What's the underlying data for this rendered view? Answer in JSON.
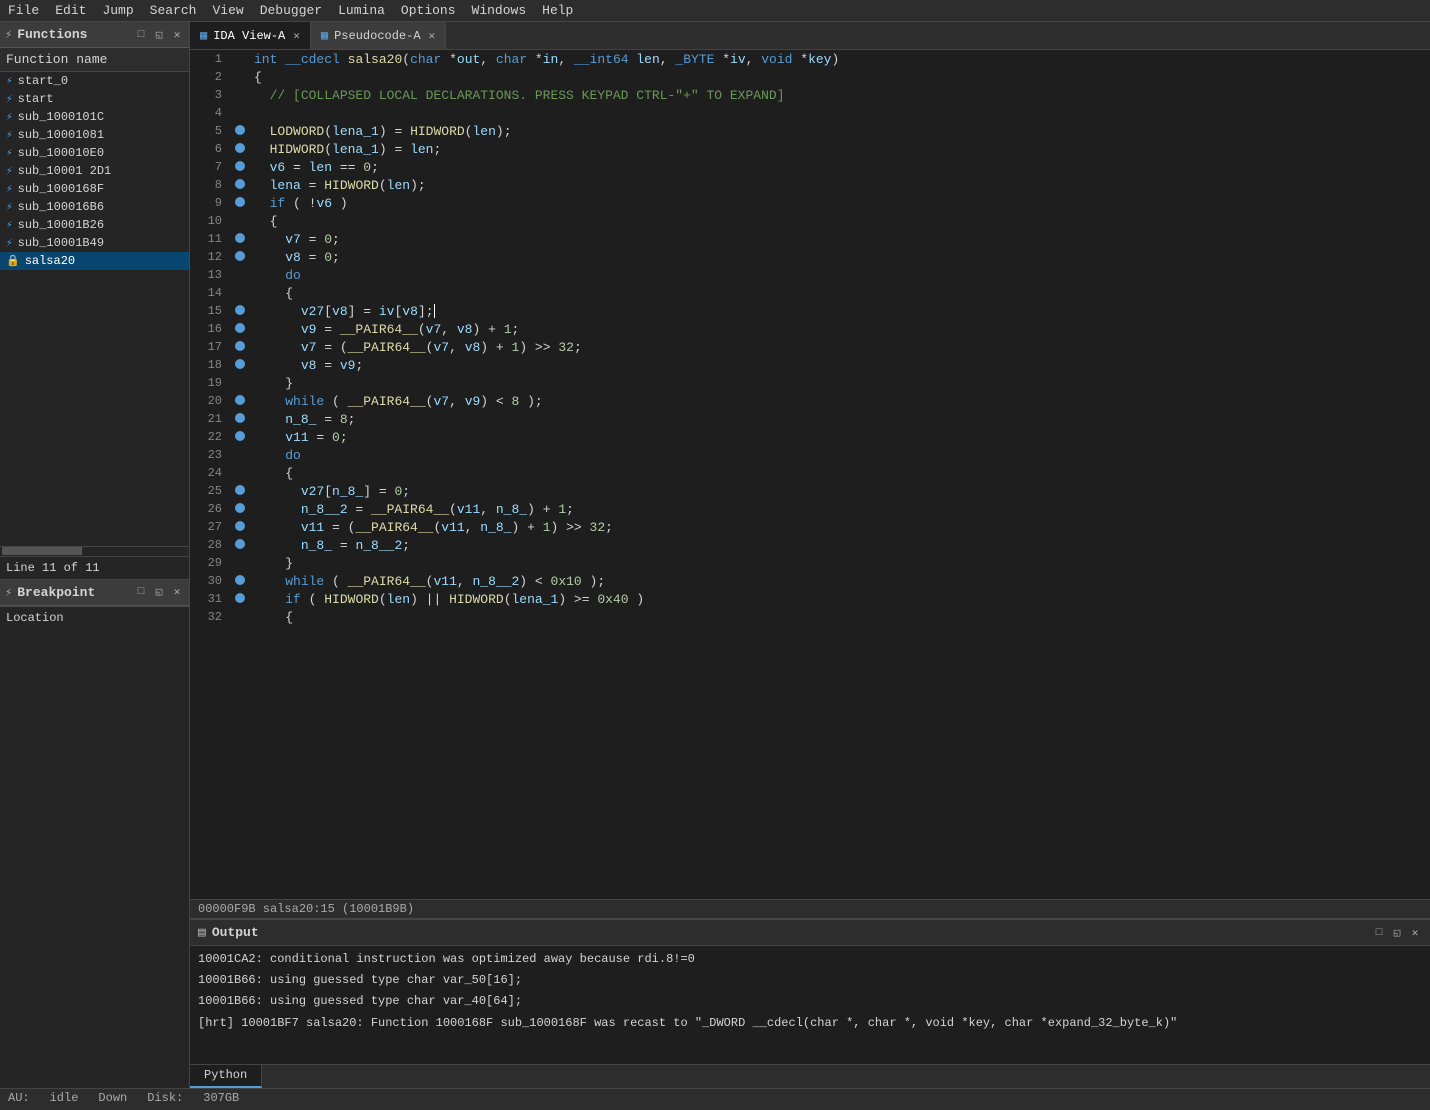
{
  "menubar": {
    "items": [
      "File",
      "Edit",
      "Jump",
      "Search",
      "View",
      "Debugger",
      "Lumina",
      "Options",
      "Windows",
      "Help"
    ]
  },
  "left_panel": {
    "title": "Functions",
    "title_icon": "⚡",
    "fn_name_label": "Function name",
    "functions": [
      {
        "name": "start_0",
        "type": "function",
        "active": false
      },
      {
        "name": "start",
        "type": "function",
        "active": false
      },
      {
        "name": "sub_1000101C",
        "type": "function",
        "active": false
      },
      {
        "name": "sub_10001081",
        "type": "function",
        "active": false
      },
      {
        "name": "sub_100010E0",
        "type": "function",
        "active": false
      },
      {
        "name": "sub_10001 2D1",
        "type": "function",
        "active": false
      },
      {
        "name": "sub_1000168F",
        "type": "function",
        "active": false
      },
      {
        "name": "sub_100016B6",
        "type": "function",
        "active": false
      },
      {
        "name": "sub_10001B26",
        "type": "function",
        "active": false
      },
      {
        "name": "sub_10001B49",
        "type": "function",
        "active": false
      },
      {
        "name": "salsa20",
        "type": "function_lock",
        "active": true
      }
    ],
    "line_info": "Line 11 of 11",
    "breakpoint_title": "Breakpoint",
    "location_label": "Location"
  },
  "tabs": {
    "ida_view": {
      "label": "IDA View-A",
      "active": true,
      "icon": "▦"
    },
    "pseudocode": {
      "label": "Pseudocode-A",
      "active": false,
      "icon": "▦"
    }
  },
  "code": {
    "lines": [
      {
        "num": 1,
        "bp": false,
        "text": "int __cdecl salsa20(char *out, char *in, __int64 len, _BYTE *iv, void *key)"
      },
      {
        "num": 2,
        "bp": false,
        "text": "{"
      },
      {
        "num": 3,
        "bp": false,
        "text": "  // [COLLAPSED LOCAL DECLARATIONS. PRESS KEYPAD CTRL-\"+\" TO EXPAND]"
      },
      {
        "num": 4,
        "bp": false,
        "text": ""
      },
      {
        "num": 5,
        "bp": true,
        "text": "  LODWORD(lena_1) = HIDWORD(len);"
      },
      {
        "num": 6,
        "bp": true,
        "text": "  HIDWORD(lena_1) = len;"
      },
      {
        "num": 7,
        "bp": true,
        "text": "  v6 = len == 0;"
      },
      {
        "num": 8,
        "bp": true,
        "text": "  lena = HIDWORD(len);"
      },
      {
        "num": 9,
        "bp": true,
        "text": "  if ( !v6 )"
      },
      {
        "num": 10,
        "bp": false,
        "text": "  {"
      },
      {
        "num": 11,
        "bp": true,
        "text": "    v7 = 0;"
      },
      {
        "num": 12,
        "bp": true,
        "text": "    v8 = 0;"
      },
      {
        "num": 13,
        "bp": false,
        "text": "    do"
      },
      {
        "num": 14,
        "bp": false,
        "text": "    {"
      },
      {
        "num": 15,
        "bp": true,
        "text": "      v27[v8] = iv[v8];"
      },
      {
        "num": 16,
        "bp": true,
        "text": "      v9 = __PAIR64__(v7, v8) + 1;"
      },
      {
        "num": 17,
        "bp": true,
        "text": "      v7 = (__PAIR64__(v7, v8) + 1) >> 32;"
      },
      {
        "num": 18,
        "bp": true,
        "text": "      v8 = v9;"
      },
      {
        "num": 19,
        "bp": false,
        "text": "    }"
      },
      {
        "num": 20,
        "bp": true,
        "text": "    while ( __PAIR64__(v7, v9) < 8 );"
      },
      {
        "num": 21,
        "bp": true,
        "text": "    n_8_ = 8;"
      },
      {
        "num": 22,
        "bp": true,
        "text": "    v11 = 0;"
      },
      {
        "num": 23,
        "bp": false,
        "text": "    do"
      },
      {
        "num": 24,
        "bp": false,
        "text": "    {"
      },
      {
        "num": 25,
        "bp": true,
        "text": "      v27[n_8_] = 0;"
      },
      {
        "num": 26,
        "bp": true,
        "text": "      n_8__2 = __PAIR64__(v11, n_8_) + 1;"
      },
      {
        "num": 27,
        "bp": true,
        "text": "      v11 = (__PAIR64__(v11, n_8_) + 1) >> 32;"
      },
      {
        "num": 28,
        "bp": true,
        "text": "      n_8_ = n_8__2;"
      },
      {
        "num": 29,
        "bp": false,
        "text": "    }"
      },
      {
        "num": 30,
        "bp": true,
        "text": "    while ( __PAIR64__(v11, n_8__2) < 0x10 );"
      },
      {
        "num": 31,
        "bp": true,
        "text": "    if ( HIDWORD(len) || HIDWORD(lena_1) >= 0x40 )"
      },
      {
        "num": 32,
        "bp": false,
        "text": "    {"
      }
    ],
    "status_text": "00000F9B salsa20:15 (10001B9B)"
  },
  "output": {
    "title": "Output",
    "lines": [
      "10001CA2: conditional instruction was optimized away because rdi.8!=0",
      "10001B66: using guessed type char var_50[16];",
      "10001B66: using guessed type char var_40[64];",
      "[hrt] 10001BF7 salsa20: Function 1000168F sub_1000168F was recast to \"_DWORD __cdecl(char *, char *, void *key, char *expand_32_byte_k)\""
    ]
  },
  "bottom_tabs": [
    "Python"
  ],
  "status_bar": {
    "au": "AU:",
    "state": "idle",
    "down_label": "Down",
    "disk_label": "Disk:",
    "disk_value": "307GB"
  }
}
